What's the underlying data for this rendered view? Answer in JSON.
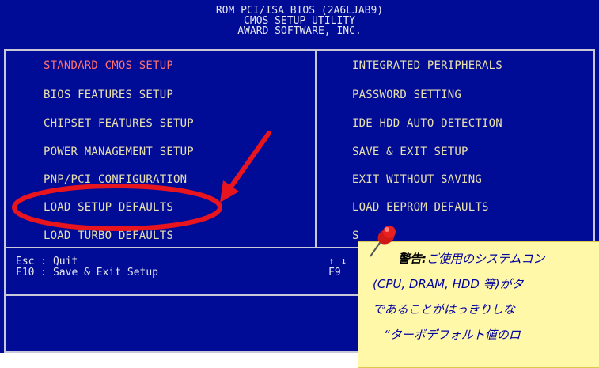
{
  "header": {
    "line1": "ROM PCI/ISA BIOS (2A6LJAB9)",
    "line2": "CMOS SETUP UTILITY",
    "line3": "AWARD SOFTWARE, INC."
  },
  "menu_left": [
    {
      "label": "STANDARD CMOS SETUP"
    },
    {
      "label": "BIOS FEATURES SETUP"
    },
    {
      "label": "CHIPSET FEATURES SETUP"
    },
    {
      "label": "POWER MANAGEMENT SETUP"
    },
    {
      "label": "PNP/PCI CONFIGURATION"
    },
    {
      "label": "LOAD SETUP DEFAULTS"
    },
    {
      "label": "LOAD TURBO DEFAULTS"
    }
  ],
  "menu_right": [
    {
      "label": "INTEGRATED PERIPHERALS"
    },
    {
      "label": "PASSWORD SETTING"
    },
    {
      "label": "IDE HDD AUTO DETECTION"
    },
    {
      "label": "SAVE & EXIT SETUP"
    },
    {
      "label": "EXIT WITHOUT SAVING"
    },
    {
      "label": "LOAD EEPROM DEFAULTS"
    },
    {
      "label": "S"
    }
  ],
  "help": {
    "left": "Esc : Quit\nF10 : Save & Exit Setup",
    "right": "↑ ↓\nF9"
  },
  "note": {
    "warning_label": "警告:",
    "line1": "ご使用のシステムコン",
    "line2": "(CPU, DRAM, HDD 等)がタ",
    "line3": "であることがはっきりしな",
    "line4": "“ターボデフォルト値のロ"
  },
  "colors": {
    "bios_bg": "#000c96",
    "menu_text": "#e8e0b0",
    "selected_text": "#ff7070",
    "annotation_red": "#e8141e",
    "note_bg": "#fff8a8"
  }
}
